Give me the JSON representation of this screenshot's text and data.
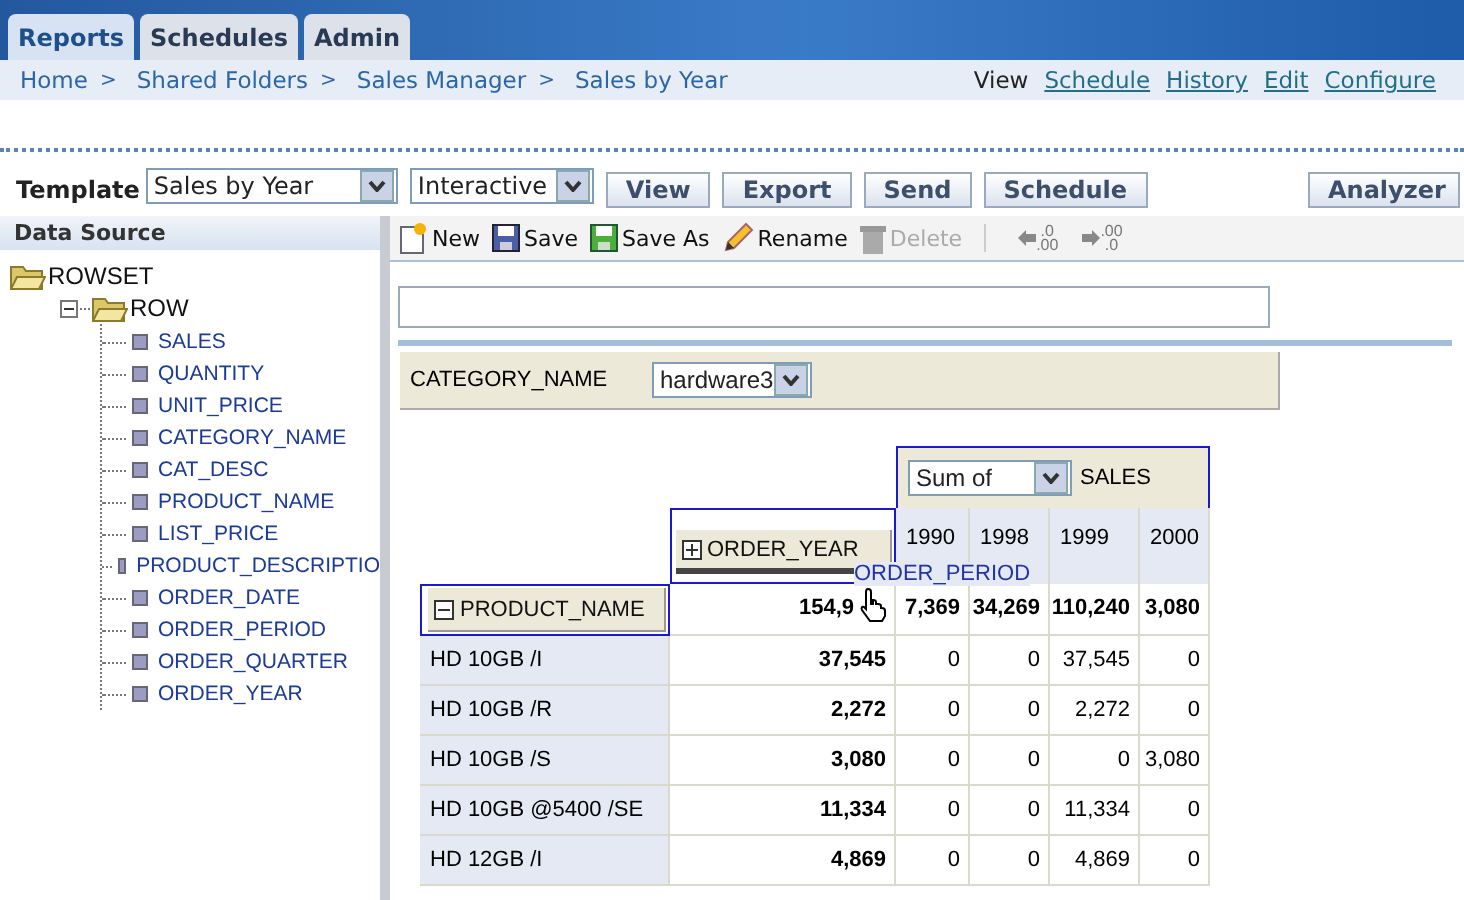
{
  "tabs": [
    {
      "label": "Reports",
      "selected": true
    },
    {
      "label": "Schedules",
      "selected": false
    },
    {
      "label": "Admin",
      "selected": false
    }
  ],
  "breadcrumb": [
    {
      "label": "Home",
      "separator": ">"
    },
    {
      "label": "Shared Folders",
      "separator": ">"
    },
    {
      "label": "Sales Manager",
      "separator": ">"
    },
    {
      "label": "Sales by Year"
    }
  ],
  "view_links": [
    {
      "label": "View",
      "selected": true
    },
    {
      "label": "Schedule",
      "selected": false
    },
    {
      "label": "History",
      "selected": false
    },
    {
      "label": "Edit",
      "selected": false
    },
    {
      "label": "Configure",
      "selected": false
    }
  ],
  "template_bar": {
    "label": "Template",
    "template": "Sales by Year",
    "mode": "Interactive",
    "buttons": [
      "View",
      "Export",
      "Send",
      "Schedule"
    ],
    "analyzer": "Analyzer"
  },
  "data_source": {
    "title": "Data Source",
    "tree": [
      {
        "label": "ROWSET",
        "kind": "folder",
        "children": [
          {
            "label": "ROW",
            "kind": "folder",
            "expanded": true,
            "children": [
              {
                "label": "SALES",
                "kind": "field"
              },
              {
                "label": "QUANTITY",
                "kind": "field"
              },
              {
                "label": "UNIT_PRICE",
                "kind": "field"
              },
              {
                "label": "CATEGORY_NAME",
                "kind": "field"
              },
              {
                "label": "CAT_DESC",
                "kind": "field"
              },
              {
                "label": "PRODUCT_NAME",
                "kind": "field"
              },
              {
                "label": "LIST_PRICE",
                "kind": "field"
              },
              {
                "label": "PRODUCT_DESCRIPTIO",
                "kind": "field"
              },
              {
                "label": "ORDER_DATE",
                "kind": "field"
              },
              {
                "label": "ORDER_PERIOD",
                "kind": "field"
              },
              {
                "label": "ORDER_QUARTER",
                "kind": "field"
              },
              {
                "label": "ORDER_YEAR",
                "kind": "field"
              }
            ]
          }
        ]
      }
    ]
  },
  "editor_toolbar": [
    {
      "kind": "new",
      "label": "New",
      "disabled": false
    },
    {
      "kind": "save",
      "label": "Save",
      "disabled": false
    },
    {
      "kind": "save_as",
      "label": "Save As",
      "disabled": false
    },
    {
      "kind": "rename",
      "label": "Rename",
      "disabled": false
    },
    {
      "kind": "delete",
      "label": "Delete",
      "disabled": true
    },
    {
      "kind": "decimal_less",
      "top": ".0",
      "bottom": ".00"
    },
    {
      "kind": "decimal_more",
      "top": ".00",
      "bottom": ".0"
    }
  ],
  "page_filter": {
    "label": "CATEGORY_NAME",
    "value": "hardware3"
  },
  "pivot": {
    "aggregate": "Sum of",
    "measure": "SALES",
    "column_field": {
      "label": "ORDER_YEAR",
      "expanded": false
    },
    "row_field": {
      "label": "PRODUCT_NAME",
      "expanded": true
    },
    "dragging": "ORDER_PERIOD",
    "columns": [
      "1990",
      "1998",
      "1999",
      "2000"
    ],
    "total_row": {
      "total": "154,9",
      "values": [
        "7,369",
        "34,269",
        "110,240",
        "3,080"
      ]
    },
    "rows": [
      {
        "label": "HD 10GB /I",
        "total": "37,545",
        "values": [
          "0",
          "0",
          "37,545",
          "0"
        ]
      },
      {
        "label": "HD 10GB /R",
        "total": "2,272",
        "values": [
          "0",
          "0",
          "2,272",
          "0"
        ]
      },
      {
        "label": "HD 10GB /S",
        "total": "3,080",
        "values": [
          "0",
          "0",
          "0",
          "3,080"
        ]
      },
      {
        "label": "HD 10GB @5400 /SE",
        "total": "11,334",
        "values": [
          "0",
          "0",
          "11,334",
          "0"
        ]
      },
      {
        "label": "HD 12GB /I",
        "total": "4,869",
        "values": [
          "0",
          "0",
          "4,869",
          "0"
        ]
      }
    ]
  }
}
